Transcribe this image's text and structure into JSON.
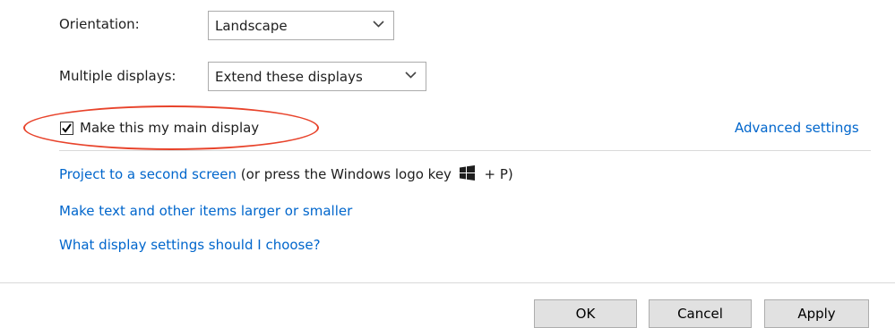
{
  "orientation": {
    "label": "Orientation:",
    "value": "Landscape"
  },
  "multiple_displays": {
    "label": "Multiple displays:",
    "value": "Extend these displays"
  },
  "main_display_checkbox": {
    "label": "Make this my main display",
    "checked": true
  },
  "advanced_settings_link": "Advanced settings",
  "project_line": {
    "link": "Project to a second screen",
    "suffix_pre": "(or press the Windows logo key",
    "suffix_post": "+ P)"
  },
  "text_size_link": "Make text and other items larger or smaller",
  "help_link": "What display settings should I choose?",
  "buttons": {
    "ok": "OK",
    "cancel": "Cancel",
    "apply": "Apply"
  },
  "colors": {
    "link": "#0066cc",
    "annotation_ellipse": "#e8432b"
  },
  "icons": {
    "chevron": "chevron-down-icon",
    "windows_logo": "windows-logo-icon",
    "check": "checkmark-icon"
  }
}
